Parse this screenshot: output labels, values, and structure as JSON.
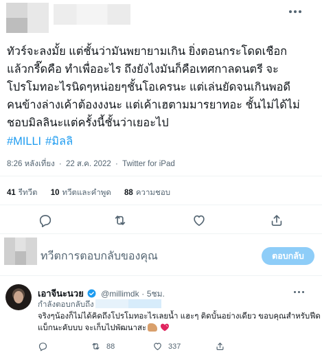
{
  "tweet": {
    "lines": [
      "ทัวร์จะลงมั้ย แต่ชั้นว่ามันพยายามเกิน ยิ่งตอนกระโดดเชือก",
      "แล้วกรี๊ดคือ ทำเพื่ออะไร ถึงยังไงมันก็คือเทศกาลดนตรี จะ",
      "โปรโมทอะไรนิดๆหน่อยๆชั้นโอเครนะ แต่เล่นยัดจนเกินพอดี",
      "คนข้างล่างเค้าต้องงงนะ แต่เค้าเฮตามมารยาทอะ ชั้นไม่ได้ไม่",
      "ชอบมิลลินะแต่ครั้งนี้ชั้นว่าเยอะไป"
    ],
    "hashtags": [
      "#MILLI",
      "#มิลลิ"
    ],
    "time": "8:26 หลังเที่ยง",
    "separator": "·",
    "date": "22 ส.ค. 2022",
    "source": "Twitter for iPad",
    "stats": {
      "retweets_count": "41",
      "retweets_label": "รีทวีต",
      "quotes_count": "10",
      "quotes_label": "ทวีตและคำพูด",
      "likes_count": "88",
      "likes_label": "ความชอบ"
    },
    "icons": [
      "reply-icon",
      "retweet-icon",
      "like-icon",
      "share-icon"
    ]
  },
  "compose": {
    "placeholder": "ทวีตการตอบกลับของคุณ",
    "button_label": "ตอบกลับ"
  },
  "reply": {
    "name": "เอาจีนะนวย",
    "handle": "@millimdk",
    "separator": "·",
    "time": "5ชม.",
    "replying_to": "กำลังตอบกลับถึง",
    "text_line1": "จริงๆน้องก็ไม่ได้คิดถึงโปรโมทอะไรเลยน้ำ แฮะๆ ติดบั้นอย่างเดียว ขอบคุณสำหรับฟีด",
    "text_line2": "แบ็กนะคับบบ จะเก็บไปพัฒนาสะ",
    "retweets": "88",
    "likes": "337"
  },
  "colors": {
    "accent": "#1d9bf0",
    "button_disabled": "#8ecdf8",
    "muted_text": "#536471",
    "divider": "#eff3f4"
  }
}
